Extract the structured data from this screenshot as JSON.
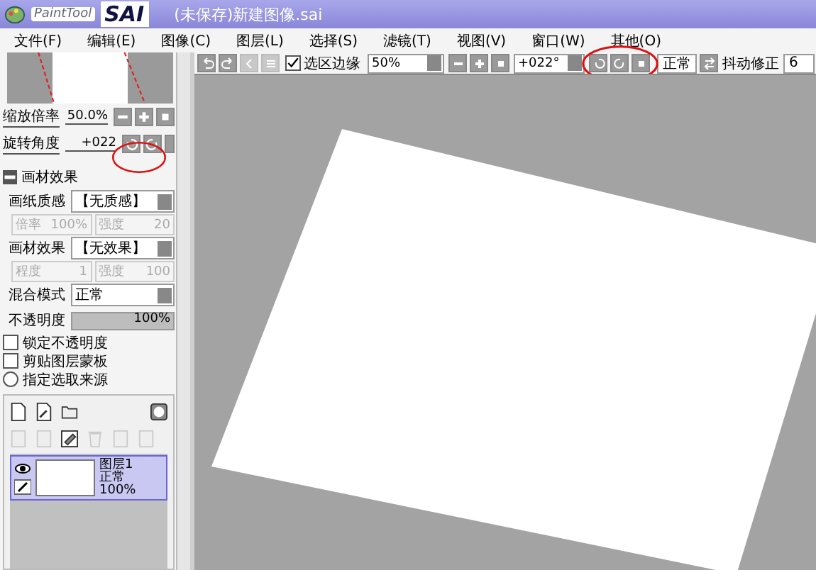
{
  "title_bar": {
    "app": "PaintTool",
    "logo": "SAI",
    "document": "(未保存)新建图像.sai"
  },
  "menu": [
    "文件(F)",
    "编辑(E)",
    "图像(C)",
    "图层(L)",
    "选择(S)",
    "滤镜(T)",
    "视图(V)",
    "窗口(W)",
    "其他(O)"
  ],
  "toolbar": {
    "selection_edge": {
      "label": "选区边缘",
      "checked": true
    },
    "zoom": "50%",
    "angle": "+022°",
    "blend": "正常",
    "stabilizer_label": "抖动修正",
    "stabilizer": "6"
  },
  "navigator": {
    "zoom_label": "缩放倍率",
    "zoom_value": "50.0%",
    "rotate_label": "旋转角度",
    "rotate_value": "+022"
  },
  "texture": {
    "title": "画材效果",
    "expanded": true,
    "groups": [
      {
        "label": "画纸质感",
        "value": "【无质感】",
        "params": [
          {
            "label": "倍率",
            "value": "100%",
            "disabled": true
          },
          {
            "label": "强度",
            "value": "20",
            "disabled": true
          }
        ]
      },
      {
        "label": "画材效果",
        "value": "【无效果】",
        "params": [
          {
            "label": "程度",
            "value": "1",
            "disabled": true
          },
          {
            "label": "强度",
            "value": "100",
            "disabled": true
          }
        ]
      }
    ]
  },
  "blend_mode": {
    "label": "混合模式",
    "value": "正常"
  },
  "opacity": {
    "label": "不透明度",
    "value": "100%",
    "level": 1
  },
  "options": [
    {
      "kind": "checkbox",
      "label": "锁定不透明度",
      "checked": false
    },
    {
      "kind": "checkbox",
      "label": "剪贴图层蒙板",
      "checked": false
    },
    {
      "kind": "radio",
      "label": "指定选取来源",
      "checked": false
    }
  ],
  "layers": [
    {
      "name": "图层1",
      "mode": "正常",
      "opacity": "100%",
      "selected": true,
      "visible": true
    }
  ]
}
